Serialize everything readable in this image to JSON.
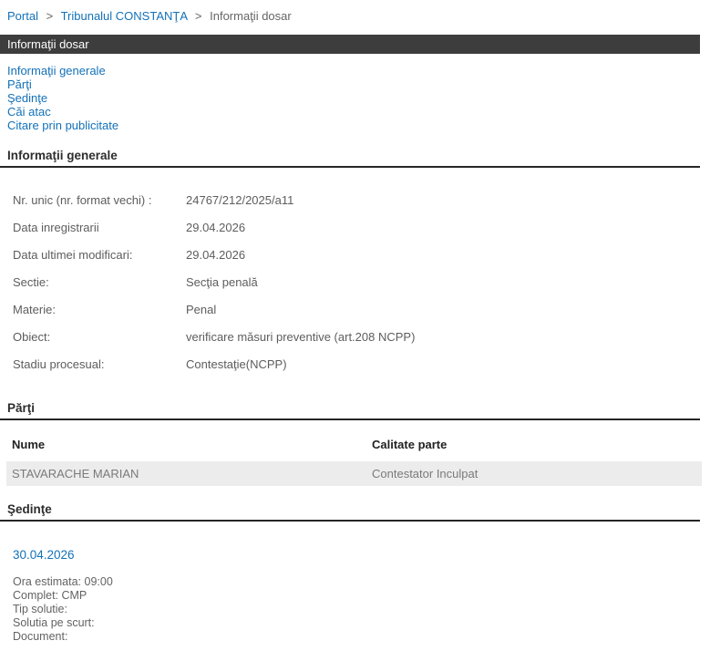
{
  "breadcrumb": {
    "separator": ">",
    "items": [
      {
        "label": "Portal"
      },
      {
        "label": "Tribunalul CONSTANŢA"
      },
      {
        "label": "Informaţii dosar"
      }
    ]
  },
  "header": {
    "title": "Informaţii dosar"
  },
  "nav": {
    "links": [
      "Informaţii generale",
      "Părţi",
      "Şedinţe",
      "Căi atac",
      "Citare prin publicitate"
    ]
  },
  "general": {
    "title": "Informaţii generale",
    "fields": [
      {
        "label": "Nr. unic (nr. format vechi) :",
        "value": "24767/212/2025/a11"
      },
      {
        "label": "Data inregistrarii",
        "value": "29.04.2026"
      },
      {
        "label": "Data ultimei modificari:",
        "value": "29.04.2026"
      },
      {
        "label": "Sectie:",
        "value": "Secţia penală"
      },
      {
        "label": "Materie:",
        "value": "Penal"
      },
      {
        "label": "Obiect:",
        "value": "verificare măsuri preventive (art.208 NCPP)"
      },
      {
        "label": "Stadiu procesual:",
        "value": "Contestaţie(NCPP)"
      }
    ]
  },
  "parties": {
    "title": "Părţi",
    "columns": [
      "Nume",
      "Calitate parte"
    ],
    "rows": [
      {
        "name": "STAVARACHE MARIAN",
        "role": "Contestator Inculpat"
      }
    ]
  },
  "hearings": {
    "title": "Şedinţe",
    "items": [
      {
        "date": "30.04.2026",
        "details": [
          "Ora estimata: 09:00",
          "Complet: CMP",
          "Tip solutie:",
          "Solutia pe scurt:",
          "Document:"
        ]
      }
    ]
  },
  "colors": {
    "link_blue": "#1371b8",
    "title_bar_bg": "#3d3d3d",
    "row_bg": "#ececec"
  }
}
